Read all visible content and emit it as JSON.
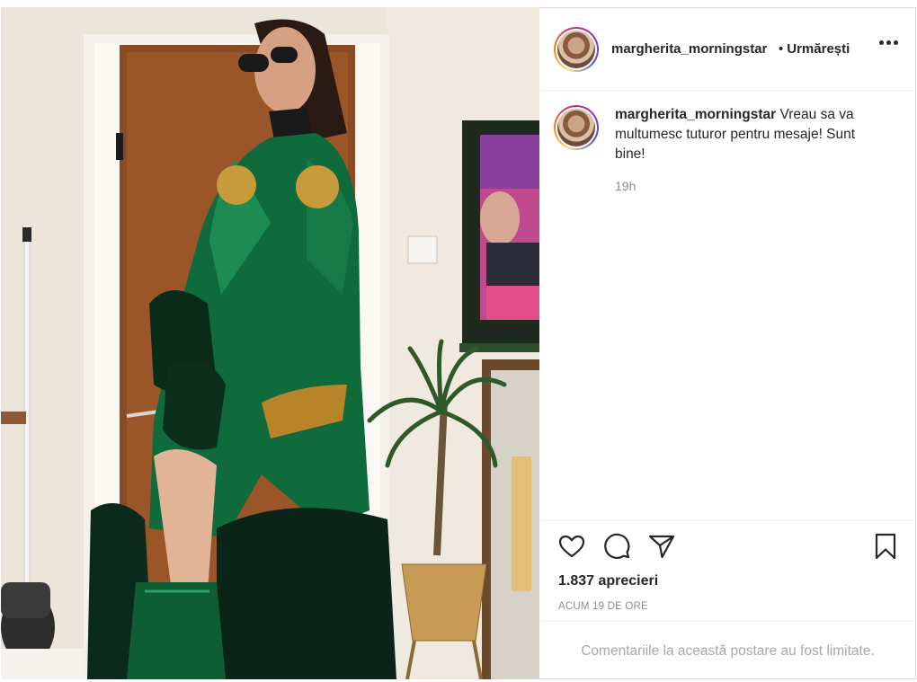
{
  "post": {
    "username": "margherita_morningstar",
    "separator": "•",
    "follow_label": "Urmărești",
    "caption": "Vreau sa va multumesc tuturor pentru mesaje! Sunt bine!",
    "caption_time": "19h",
    "likes": "1.837 aprecieri",
    "posted_ago": "ACUM 19 DE ORE",
    "comments_limited": "Comentariile la această postare au fost limitate."
  },
  "icons": {
    "more": "more-options-icon",
    "like": "heart-icon",
    "comment": "comment-bubble-icon",
    "share": "paper-plane-icon",
    "save": "bookmark-icon"
  }
}
